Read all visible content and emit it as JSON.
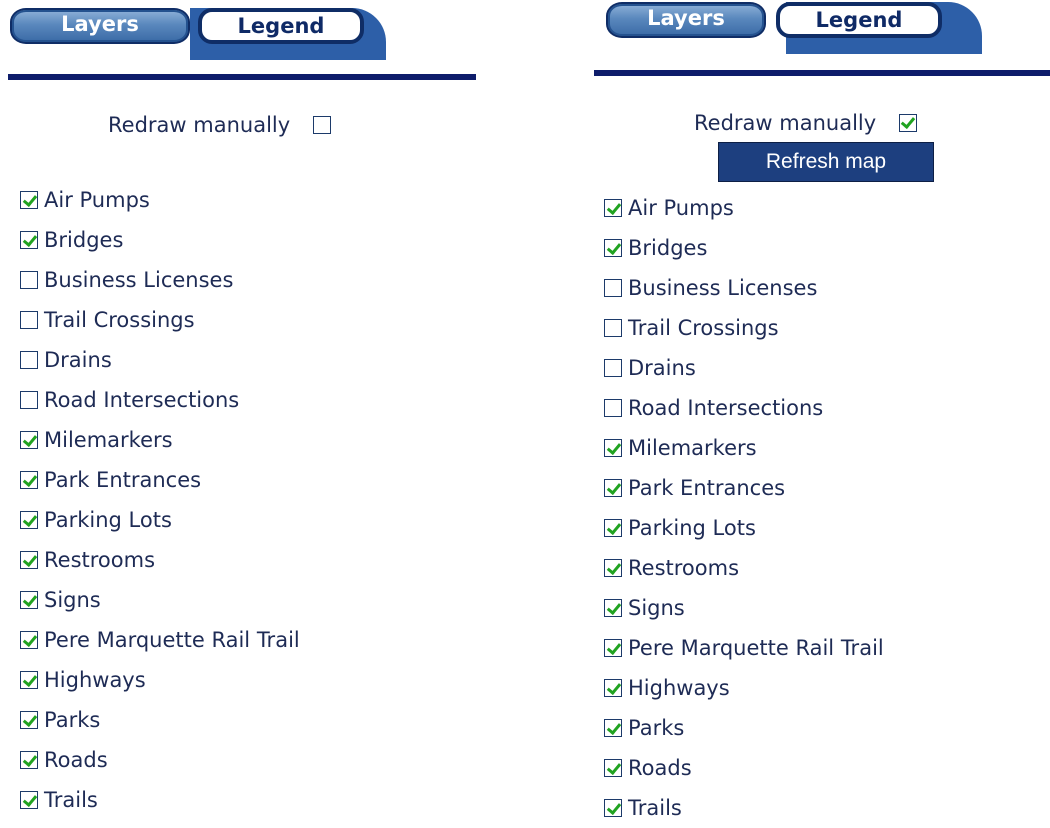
{
  "tabs": {
    "layers": "Layers",
    "legend": "Legend"
  },
  "left": {
    "redraw_label": "Redraw manually",
    "redraw_checked": false,
    "layers": [
      {
        "label": "Air Pumps",
        "checked": true
      },
      {
        "label": "Bridges",
        "checked": true
      },
      {
        "label": "Business Licenses",
        "checked": false
      },
      {
        "label": "Trail Crossings",
        "checked": false
      },
      {
        "label": "Drains",
        "checked": false
      },
      {
        "label": "Road Intersections",
        "checked": false
      },
      {
        "label": "Milemarkers",
        "checked": true
      },
      {
        "label": "Park Entrances",
        "checked": true
      },
      {
        "label": "Parking Lots",
        "checked": true
      },
      {
        "label": "Restrooms",
        "checked": true
      },
      {
        "label": "Signs",
        "checked": true
      },
      {
        "label": "Pere Marquette Rail Trail",
        "checked": true
      },
      {
        "label": "Highways",
        "checked": true
      },
      {
        "label": "Parks",
        "checked": true
      },
      {
        "label": "Roads",
        "checked": true
      },
      {
        "label": "Trails",
        "checked": true
      }
    ]
  },
  "right": {
    "redraw_label": "Redraw manually",
    "redraw_checked": true,
    "refresh_label": "Refresh map",
    "layers": [
      {
        "label": "Air Pumps",
        "checked": true
      },
      {
        "label": "Bridges",
        "checked": true
      },
      {
        "label": "Business Licenses",
        "checked": false
      },
      {
        "label": "Trail Crossings",
        "checked": false
      },
      {
        "label": "Drains",
        "checked": false
      },
      {
        "label": "Road Intersections",
        "checked": false
      },
      {
        "label": "Milemarkers",
        "checked": true
      },
      {
        "label": "Park Entrances",
        "checked": true
      },
      {
        "label": "Parking Lots",
        "checked": true
      },
      {
        "label": "Restrooms",
        "checked": true
      },
      {
        "label": "Signs",
        "checked": true
      },
      {
        "label": "Pere Marquette Rail Trail",
        "checked": true
      },
      {
        "label": "Highways",
        "checked": true
      },
      {
        "label": "Parks",
        "checked": true
      },
      {
        "label": "Roads",
        "checked": true
      },
      {
        "label": "Trails",
        "checked": true
      }
    ]
  },
  "colors": {
    "rule": "#0e1d6b",
    "checkmark": "#21a321",
    "button": "#1d3f7f",
    "text": "#1e2b55"
  }
}
